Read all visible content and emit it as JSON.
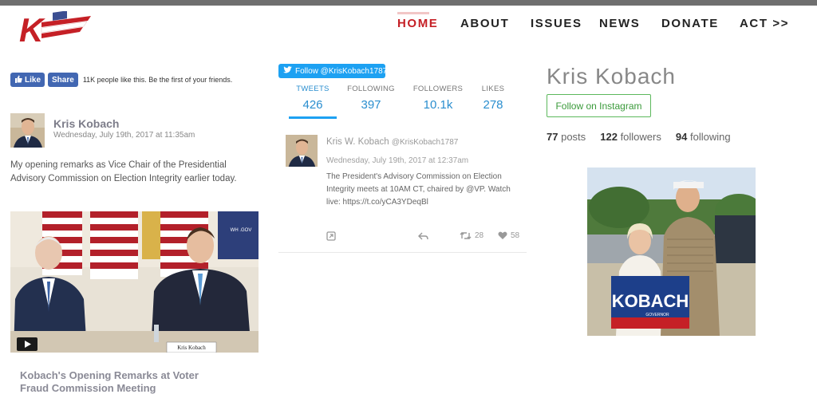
{
  "header": {
    "logo_alt": "K",
    "nav": [
      "HOME",
      "ABOUT",
      "ISSUES",
      "NEWS",
      "DONATE",
      "ACT >>"
    ]
  },
  "facebook": {
    "like_label": "Like",
    "share_label": "Share",
    "like_count_text": "11K people like this. Be the first of your friends.",
    "post": {
      "author": "Kris Kobach",
      "date": "Wednesday, July 19th, 2017 at 11:35am",
      "text": "My opening remarks as Vice Chair of the Presidential Advisory Commission on Election Integrity earlier today.",
      "video_nameplate": "Kris Kobach",
      "video_corner": "WH .GOV",
      "caption": "Kobach's Opening Remarks at Voter Fraud Commission Meeting"
    }
  },
  "twitter": {
    "follow_label": "Follow @KrisKobach1787",
    "stats": [
      {
        "label": "TWEETS",
        "value": "426"
      },
      {
        "label": "FOLLOWING",
        "value": "397"
      },
      {
        "label": "FOLLOWERS",
        "value": "10.1k"
      },
      {
        "label": "LIKES",
        "value": "278"
      }
    ],
    "tweet": {
      "name": "Kris W. Kobach",
      "handle": "@KrisKobach1787",
      "date": "Wednesday, July 19th, 2017 at 12:37am",
      "text": "The President's Advisory Commission on Election Integrity meets at 10AM CT, chaired by @VP. Watch live: https://t.co/yCA3YDeqBl",
      "retweets": "28",
      "likes": "58"
    }
  },
  "instagram": {
    "name": "Kris Kobach",
    "follow_label": "Follow on Instagram",
    "posts": "77",
    "posts_label": "posts",
    "followers": "122",
    "followers_label": "followers",
    "following": "94",
    "following_label": "following",
    "sign_text": "KOBACH",
    "sign_sub": "GOVERNOR"
  },
  "colors": {
    "brand_red": "#c52026",
    "facebook_blue": "#4267b2",
    "twitter_blue": "#1da1f2",
    "instagram_green": "#5cb85c"
  }
}
